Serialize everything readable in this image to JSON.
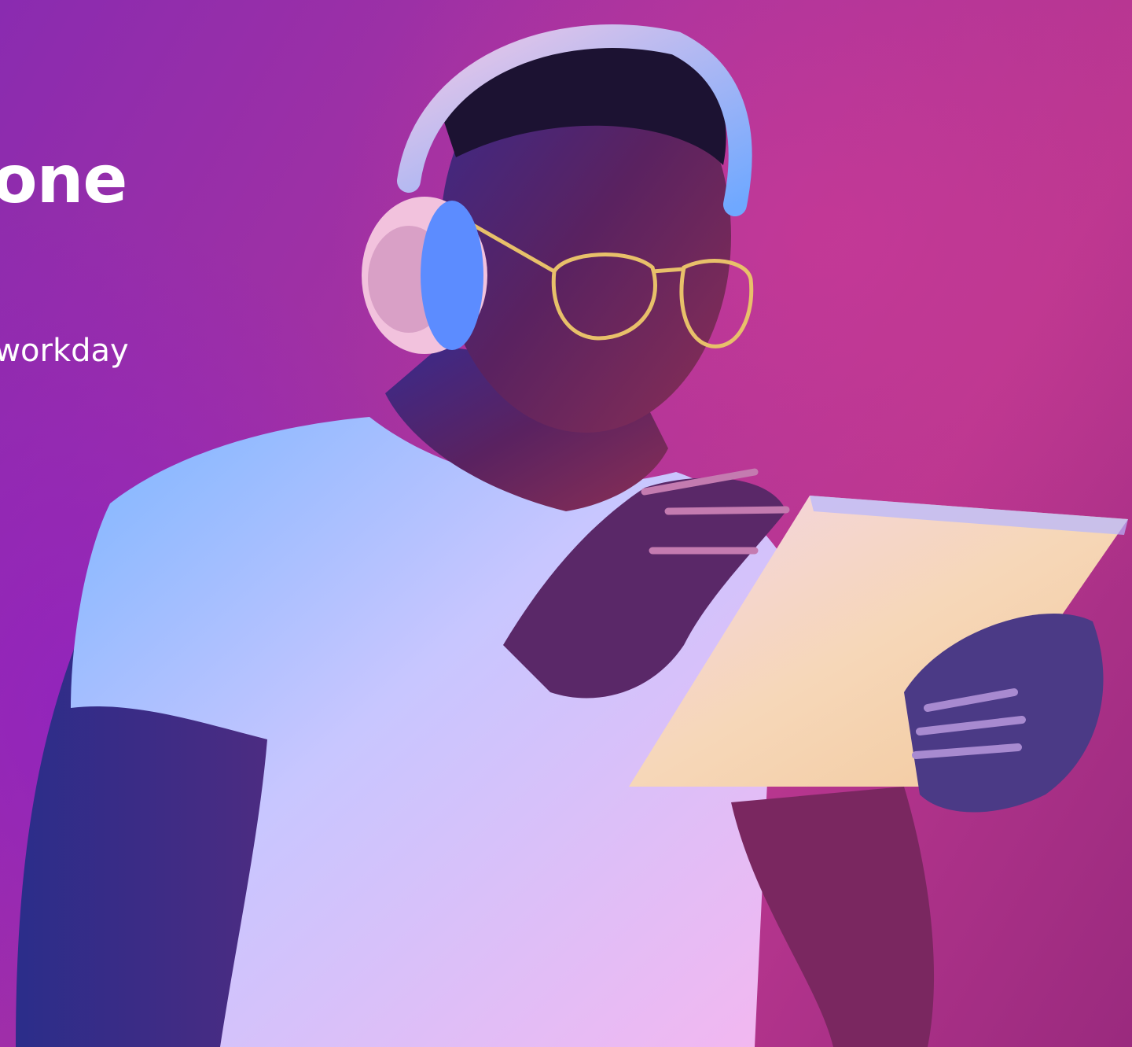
{
  "hero": {
    "title": "Zone",
    "subtitle": "e workday",
    "background_color": "#a8339f",
    "accent_color": "#ffffff"
  },
  "photo": {
    "subject": "person-with-headphones-and-tablet"
  }
}
